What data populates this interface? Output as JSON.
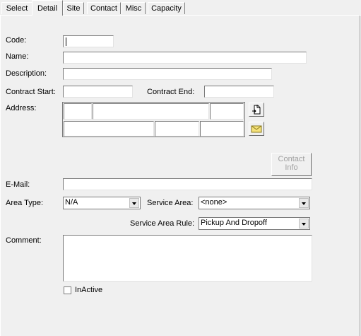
{
  "tabs": [
    {
      "label": "Select"
    },
    {
      "label": "Detail"
    },
    {
      "label": "Site"
    },
    {
      "label": "Contact"
    },
    {
      "label": "Misc"
    },
    {
      "label": "Capacity"
    }
  ],
  "form": {
    "code_label": "Code:",
    "name_label": "Name:",
    "description_label": "Description:",
    "contract_start_label": "Contract Start:",
    "contract_end_label": "Contract End:",
    "address_label": "Address:",
    "contact_info_button": "Contact Info",
    "email_label": "E-Mail:",
    "area_type_label": "Area Type:",
    "area_type_value": "N/A",
    "service_area_label": "Service Area:",
    "service_area_value": "<none>",
    "service_area_rule_label": "Service Area Rule:",
    "service_area_rule_value": "Pickup And Dropoff",
    "comment_label": "Comment:",
    "inactive_label": "InActive"
  },
  "icons": {
    "address_lookup": "document-lookup-icon",
    "email": "envelope-icon"
  }
}
